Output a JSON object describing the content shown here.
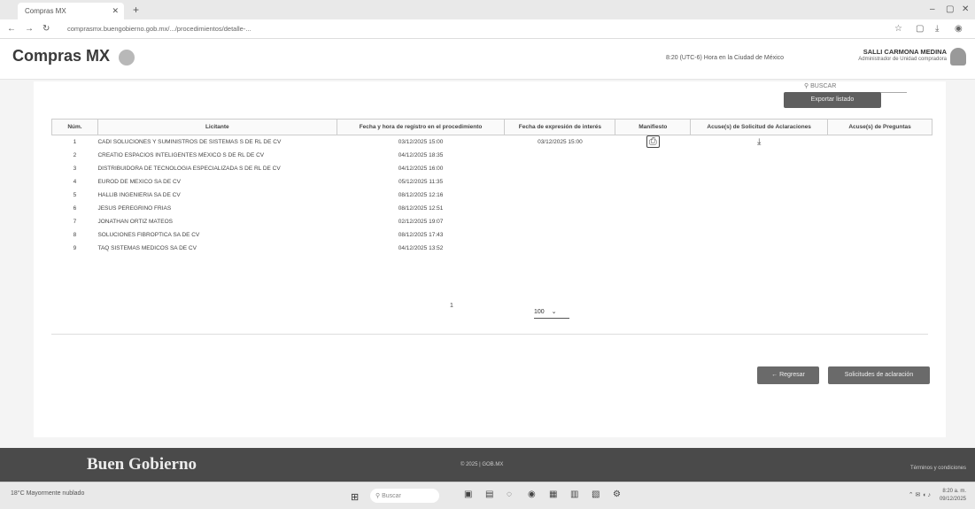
{
  "browser": {
    "tab_title": "Compras MX",
    "url": "comprasmx.buengobierno.gob.mx/.../procedimientos/detalle-...",
    "new_tab_icon": "+"
  },
  "header": {
    "logo": "Compras MX",
    "timezone": "8:20 (UTC-6) Hora en la Ciudad de México",
    "user_name": "SALLI CARMONA MEDINA",
    "user_role": "Administrador de Unidad compradora"
  },
  "toolbar": {
    "search_placeholder": "BUSCAR",
    "export_label": "Exportar listado"
  },
  "table": {
    "columns": [
      "Núm.",
      "Licitante",
      "Fecha y hora de registro en el procedimiento",
      "Fecha de expresión de interés",
      "Manifiesto",
      "Acuse(s) de Solicitud de Aclaraciones",
      "Acuse(s) de Preguntas"
    ],
    "rows": [
      {
        "num": "1",
        "licitante": "CADI SOLUCIONES Y SUMINISTROS DE SISTEMAS S DE RL DE CV",
        "registro": "03/12/2025 15:00",
        "interes": "03/12/2025 15:00"
      },
      {
        "num": "2",
        "licitante": "CREATIO ESPACIOS INTELIGENTES MEXICO S DE RL DE CV",
        "registro": "04/12/2025 18:35",
        "interes": ""
      },
      {
        "num": "3",
        "licitante": "DISTRIBUIDORA DE TECNOLOGIA ESPECIALIZADA S DE RL DE CV",
        "registro": "04/12/2025 16:00",
        "interes": ""
      },
      {
        "num": "4",
        "licitante": "EUROD DE MEXICO SA DE CV",
        "registro": "05/12/2025 11:35",
        "interes": ""
      },
      {
        "num": "5",
        "licitante": "HALLIB INGENIERIA SA DE CV",
        "registro": "08/12/2025 12:16",
        "interes": ""
      },
      {
        "num": "6",
        "licitante": "JESUS PEREGRINO FRIAS",
        "registro": "08/12/2025 12:51",
        "interes": ""
      },
      {
        "num": "7",
        "licitante": "JONATHAN ORTIZ MATEOS",
        "registro": "02/12/2025 19:07",
        "interes": ""
      },
      {
        "num": "8",
        "licitante": "SOLUCIONES FIBROPTICA SA DE CV",
        "registro": "08/12/2025 17:43",
        "interes": ""
      },
      {
        "num": "9",
        "licitante": "TAQ SISTEMAS MEDICOS SA DE CV",
        "registro": "04/12/2025 13:52",
        "interes": ""
      }
    ]
  },
  "pagination": {
    "page": "1",
    "page_size": "100"
  },
  "actions": {
    "back_label": "← Regresar",
    "solicitudes_label": "Solicitudes de aclaración"
  },
  "footer": {
    "title": "Buen Gobierno",
    "copyright": "© 2025 | GOB.MX",
    "terms": "Términos y condiciones"
  },
  "taskbar": {
    "weather": "18°C Mayormente nublado",
    "search_placeholder": "Buscar",
    "time": "8:20 a. m.",
    "date": "09/12/2025"
  }
}
